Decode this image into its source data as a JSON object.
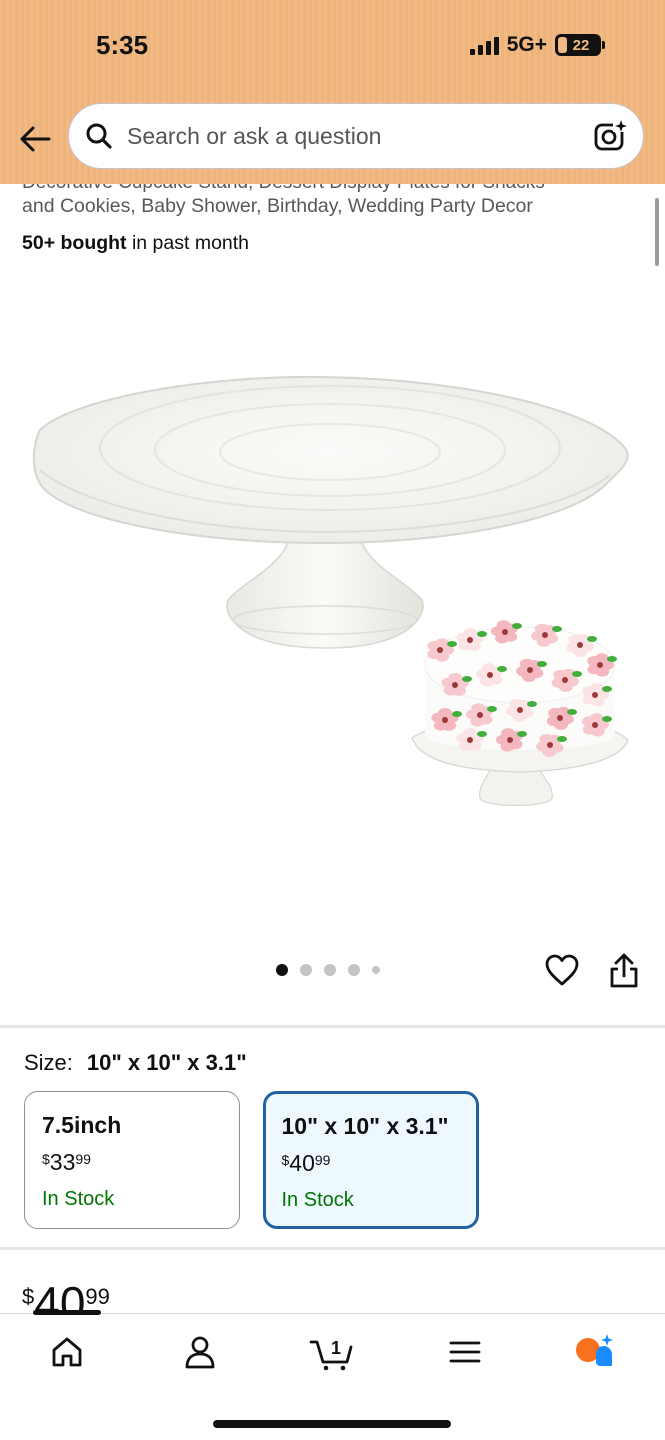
{
  "status_bar": {
    "time": "5:35",
    "network": "5G+",
    "battery": "22",
    "battery_level": 0.22
  },
  "search": {
    "placeholder": "Search or ask a question",
    "search_icon": "search-icon",
    "camera_icon": "camera-sparkle-icon"
  },
  "product": {
    "title_partial_line": "Decorative Cupcake Stand, Dessert Display Plates for Snacks",
    "title_line": "and Cookies, Baby Shower, Birthday, Wedding Party Decor",
    "bought_count": "50+ bought",
    "bought_suffix": " in past month",
    "image_count": 5,
    "active_image": 0
  },
  "size": {
    "label": "Size:",
    "selected_value": "10\" x 10\" x 3.1\"",
    "options": [
      {
        "name": "7.5inch",
        "currency": "$",
        "whole": "33",
        "cents": "99",
        "stock": "In Stock",
        "selected": false
      },
      {
        "name": "10\" x 10\" x 3.1\"",
        "currency": "$",
        "whole": "40",
        "cents": "99",
        "stock": "In Stock",
        "selected": true
      }
    ]
  },
  "price": {
    "currency": "$",
    "whole": "40",
    "cents": "99"
  },
  "bottom_nav": {
    "items": [
      "home-icon",
      "account-icon",
      "cart-icon",
      "menu-icon",
      "rufus-ai-icon"
    ],
    "cart_count": "1",
    "active": "home"
  },
  "colors": {
    "header_bg": "#f1b983",
    "selected_border": "#2162a1",
    "selected_bg": "#edf8ff",
    "in_stock": "#007600",
    "rufus_orange": "#f7711e",
    "rufus_blue": "#1a8cff"
  }
}
